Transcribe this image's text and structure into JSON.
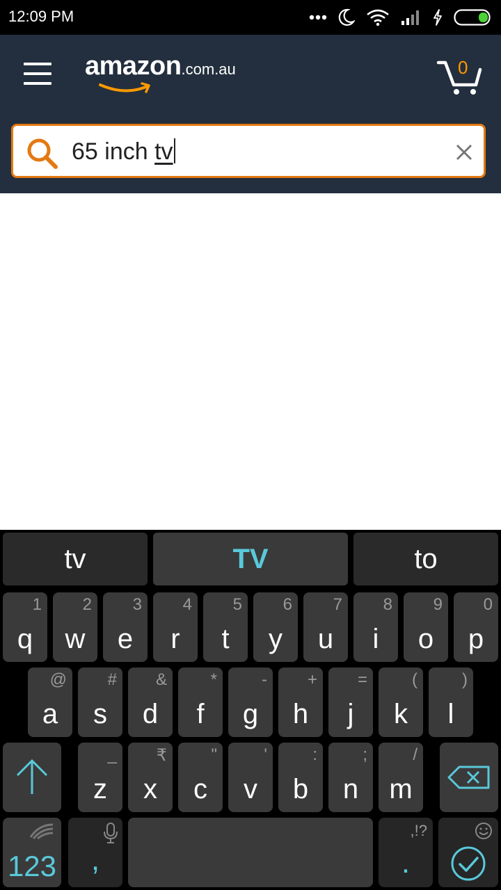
{
  "status_bar": {
    "time": "12:09 PM"
  },
  "header": {
    "logo_main": "amazon",
    "logo_suffix": ".com.au",
    "cart_count": "0"
  },
  "search": {
    "query_prefix": "65 inch ",
    "query_last_word": "tv"
  },
  "keyboard": {
    "suggestions": [
      "tv",
      "TV",
      "to"
    ],
    "row1": [
      {
        "key": "q",
        "sec": "1"
      },
      {
        "key": "w",
        "sec": "2"
      },
      {
        "key": "e",
        "sec": "3"
      },
      {
        "key": "r",
        "sec": "4"
      },
      {
        "key": "t",
        "sec": "5"
      },
      {
        "key": "y",
        "sec": "6"
      },
      {
        "key": "u",
        "sec": "7"
      },
      {
        "key": "i",
        "sec": "8"
      },
      {
        "key": "o",
        "sec": "9"
      },
      {
        "key": "p",
        "sec": "0"
      }
    ],
    "row2": [
      {
        "key": "a",
        "sec": "@"
      },
      {
        "key": "s",
        "sec": "#"
      },
      {
        "key": "d",
        "sec": "&"
      },
      {
        "key": "f",
        "sec": "*"
      },
      {
        "key": "g",
        "sec": "-"
      },
      {
        "key": "h",
        "sec": "+"
      },
      {
        "key": "j",
        "sec": "="
      },
      {
        "key": "k",
        "sec": "("
      },
      {
        "key": "l",
        "sec": ")"
      }
    ],
    "row3": [
      {
        "key": "z",
        "sec": "_"
      },
      {
        "key": "x",
        "sec": "₹"
      },
      {
        "key": "c",
        "sec": "\""
      },
      {
        "key": "v",
        "sec": "'"
      },
      {
        "key": "b",
        "sec": ":"
      },
      {
        "key": "n",
        "sec": ";"
      },
      {
        "key": "m",
        "sec": "/"
      }
    ],
    "numbers_label": "123",
    "comma_label": ",",
    "period_label": ".",
    "period_sec": ",!?"
  },
  "colors": {
    "header_bg": "#232f3e",
    "accent_orange": "#e47911",
    "keyboard_accent": "#59c9da"
  }
}
